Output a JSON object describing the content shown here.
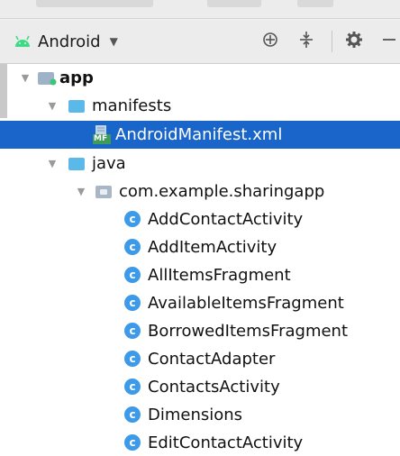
{
  "header": {
    "view_label": "Android",
    "icons": {
      "view": "android-icon",
      "dropdown": "chevron-down-icon",
      "locate": "crosshair-icon",
      "collapse": "collapse-all-icon",
      "settings": "gear-icon",
      "hide": "minus-icon"
    }
  },
  "colors": {
    "selection": "#1a65c9",
    "folder": "#5ab9e8",
    "class_icon": "#3d9ae8",
    "android_green": "#3ddc84"
  },
  "tree": {
    "app": "app",
    "manifests": "manifests",
    "manifest_file": "AndroidManifest.xml",
    "manifest_badge": "MF",
    "java": "java",
    "package": "com.example.sharingapp",
    "class_badge": "c",
    "classes": [
      "AddContactActivity",
      "AddItemActivity",
      "AllItemsFragment",
      "AvailableItemsFragment",
      "BorrowedItemsFragment",
      "ContactAdapter",
      "ContactsActivity",
      "Dimensions",
      "EditContactActivity"
    ]
  }
}
